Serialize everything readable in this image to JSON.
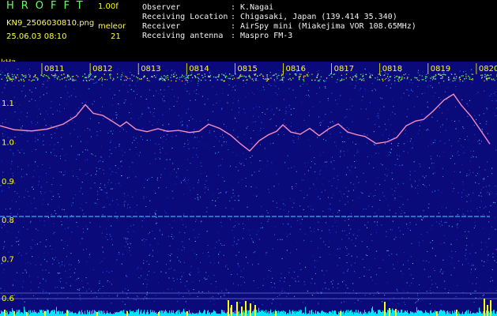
{
  "header": {
    "app_title": "HROFFT",
    "version": "1.00f",
    "filename": "KN9_2506030810.png",
    "mode_label": "meleor",
    "datetime": "25.06.03 08:10",
    "mode_value": "21",
    "info": [
      {
        "label": "Observer",
        "value": ": K.Nagai"
      },
      {
        "label": "Receiving Location",
        "value": ": Chigasaki, Japan (139.414 35.340)"
      },
      {
        "label": "Receiver",
        "value": ": AirSpy mini (Miakejima VOR 108.65MHz)"
      },
      {
        "label": "Receiving antenna",
        "value": ": Maspro FM-3"
      }
    ]
  },
  "spectrogram": {
    "y_unit": "kHz",
    "y_ticks": [
      "1.1",
      "1.0",
      "0.9",
      "0.8",
      "0.7",
      "0.6"
    ],
    "y_tick_values": [
      1.1,
      1.0,
      0.9,
      0.8,
      0.7,
      0.6
    ],
    "y_range": [
      0.58,
      1.15
    ],
    "time_labels": [
      "0811",
      "0812",
      "0813",
      "0814",
      "0815",
      "0816",
      "0817",
      "0818",
      "0819",
      "0820"
    ],
    "colors": {
      "background": "#0a0a7a",
      "text": "#ffff00",
      "carrier": "#cc44cc",
      "noise_floor": "#00e5ff",
      "meteor": "#ffff00"
    }
  }
}
